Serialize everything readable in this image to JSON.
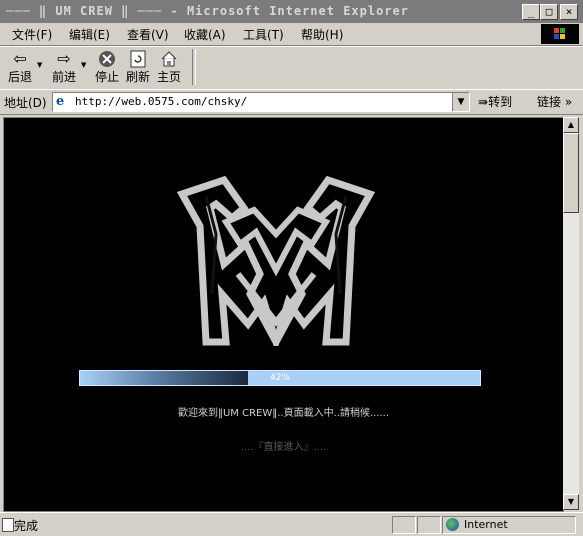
{
  "window": {
    "title": "─── ‖ UM CREW ‖ ─── - Microsoft Internet Explorer",
    "min_glyph": "_",
    "max_glyph": "□",
    "close_glyph": "×"
  },
  "menu": [
    "文件(F)",
    "编辑(E)",
    "查看(V)",
    "收藏(A)",
    "工具(T)",
    "帮助(H)"
  ],
  "toolbar": {
    "back": "后退",
    "forward": "前进",
    "stop": "停止",
    "refresh": "刷新",
    "home": "主页"
  },
  "address": {
    "label": "地址(D)",
    "url": "http://web.0575.com/chsky/",
    "go": "转到",
    "links": "链接"
  },
  "page": {
    "progress_label": "42%",
    "progress": 0.42,
    "welcome": "歡迎來到‖UM CREW‖..頁面載入中..請稍候......",
    "enter": "....『直接進入』....",
    "logo_color": "#c8c8c8"
  },
  "status": {
    "text": "完成",
    "zone": "Internet"
  }
}
